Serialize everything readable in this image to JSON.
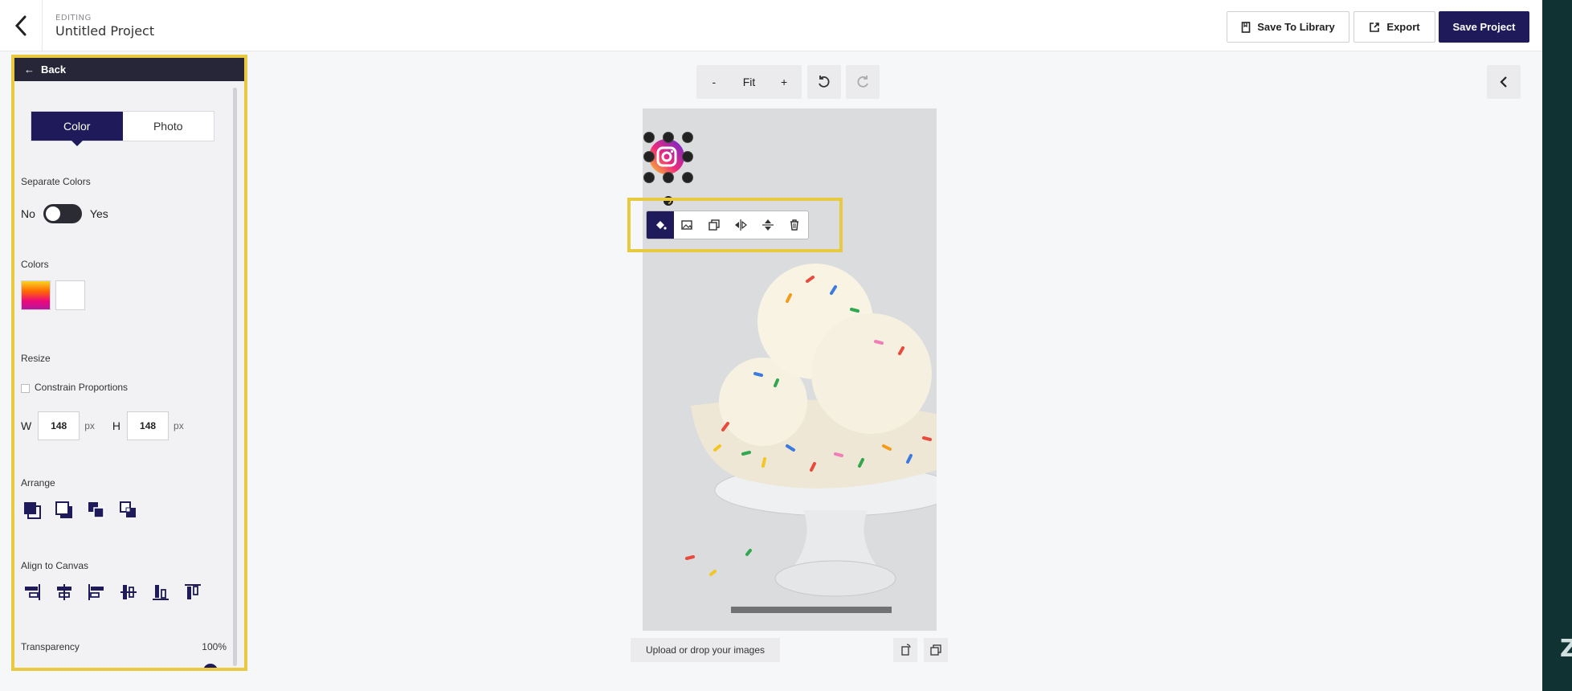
{
  "header": {
    "editing_label": "EDITING",
    "project_title": "Untitled Project",
    "save_to_library": "Save To Library",
    "export": "Export",
    "save_project": "Save Project"
  },
  "panel": {
    "back_label": "Back",
    "tabs": [
      {
        "label": "Color",
        "active": true
      },
      {
        "label": "Photo",
        "active": false
      }
    ],
    "separate_colors_label": "Separate Colors",
    "toggle_no": "No",
    "toggle_yes": "Yes",
    "toggle_state": "No",
    "colors_label": "Colors",
    "resize_label": "Resize",
    "constrain_label": "Constrain Proportions",
    "constrain_checked": false,
    "w_label": "W",
    "h_label": "H",
    "width_value": "148",
    "height_value": "148",
    "unit": "px",
    "arrange_label": "Arrange",
    "align_label": "Align to Canvas",
    "transparency_label": "Transparency",
    "transparency_value": "100%",
    "transparency_fraction": 1.0
  },
  "canvas": {
    "zoom_out": "-",
    "zoom_fit": "Fit",
    "zoom_in": "+",
    "upload_label": "Upload or drop your images"
  },
  "colors": {
    "accent": "#1f1b5b",
    "highlight": "#e8c93f",
    "dark_strip": "#103232"
  }
}
